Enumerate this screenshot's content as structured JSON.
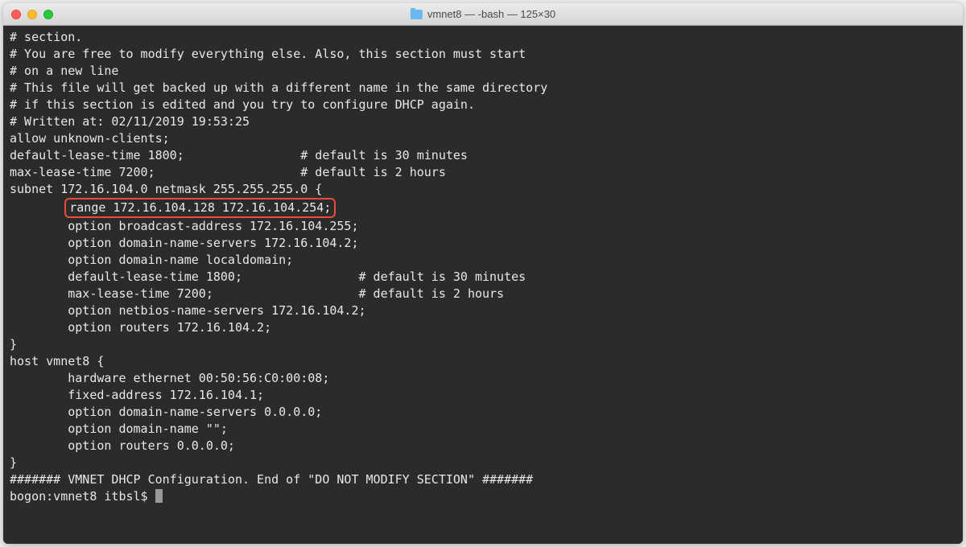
{
  "window": {
    "title": "vmnet8 — -bash — 125×30"
  },
  "terminal": {
    "lines": {
      "l0": "# section.",
      "l1": "# You are free to modify everything else. Also, this section must start",
      "l2": "# on a new line",
      "l3": "# This file will get backed up with a different name in the same directory",
      "l4": "# if this section is edited and you try to configure DHCP again.",
      "l5": "",
      "l6": "# Written at: 02/11/2019 19:53:25",
      "l7": "allow unknown-clients;",
      "l8": "default-lease-time 1800;                # default is 30 minutes",
      "l9": "max-lease-time 7200;                    # default is 2 hours",
      "l10": "",
      "l11": "subnet 172.16.104.0 netmask 255.255.255.0 {",
      "l12_highlight": "range 172.16.104.128 172.16.104.254;",
      "l13": "        option broadcast-address 172.16.104.255;",
      "l14": "        option domain-name-servers 172.16.104.2;",
      "l15": "        option domain-name localdomain;",
      "l16": "        default-lease-time 1800;                # default is 30 minutes",
      "l17": "        max-lease-time 7200;                    # default is 2 hours",
      "l18": "        option netbios-name-servers 172.16.104.2;",
      "l19": "        option routers 172.16.104.2;",
      "l20": "}",
      "l21": "host vmnet8 {",
      "l22": "        hardware ethernet 00:50:56:C0:00:08;",
      "l23": "        fixed-address 172.16.104.1;",
      "l24": "        option domain-name-servers 0.0.0.0;",
      "l25": "        option domain-name \"\";",
      "l26": "        option routers 0.0.0.0;",
      "l27": "}",
      "l28": "####### VMNET DHCP Configuration. End of \"DO NOT MODIFY SECTION\" #######",
      "prompt": "bogon:vmnet8 itbsl$ "
    },
    "indent_prefix": "        "
  }
}
